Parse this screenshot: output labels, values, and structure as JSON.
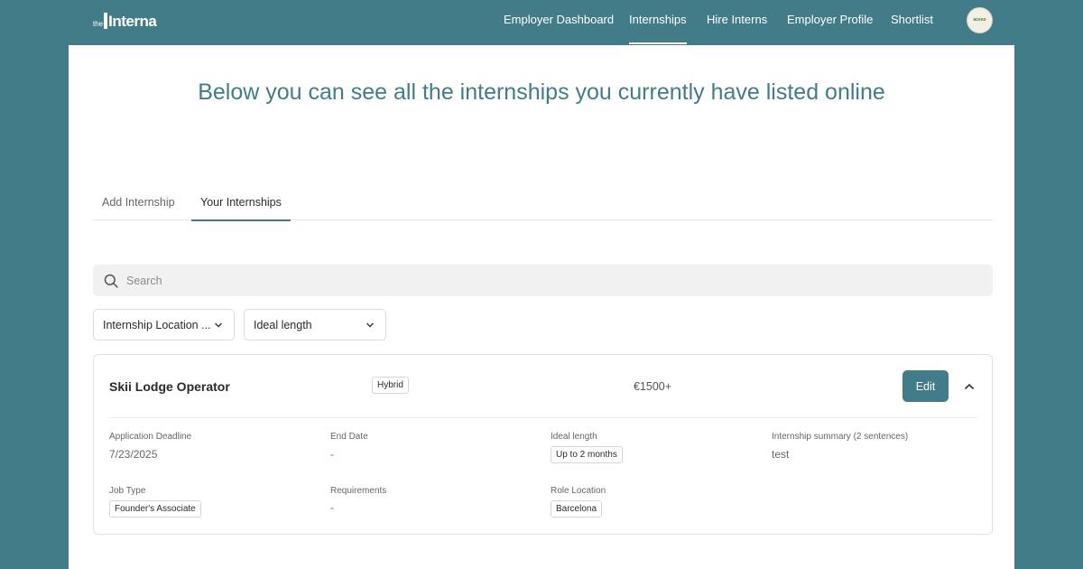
{
  "nav": {
    "logo_prefix": "the",
    "logo_text": "Interna",
    "items": [
      {
        "label": "Employer Dashboard"
      },
      {
        "label": "Internships",
        "active": true
      },
      {
        "label": "Hire Interns"
      },
      {
        "label": "Employer Profile"
      },
      {
        "label": "Shortlist"
      }
    ],
    "avatar_text": "aceso"
  },
  "page": {
    "headline": "Below you can see all the internships you currently have listed online"
  },
  "tabs": [
    {
      "label": "Add Internship"
    },
    {
      "label": "Your Internships",
      "active": true
    }
  ],
  "search": {
    "placeholder": "Search",
    "icon": "search-icon"
  },
  "filters": {
    "location": "Internship Location ...",
    "length": "Ideal length"
  },
  "internship": {
    "title": "Skii Lodge Operator",
    "work_mode": "Hybrid",
    "salary": "€1500+",
    "edit_label": "Edit",
    "fields": {
      "application_deadline": {
        "label": "Application Deadline",
        "value": "7/23/2025"
      },
      "end_date": {
        "label": "End Date",
        "value": "-"
      },
      "ideal_length": {
        "label": "Ideal length",
        "value": "Up to 2 months"
      },
      "summary": {
        "label": "Internship summary (2 sentences)",
        "value": "test"
      },
      "job_type": {
        "label": "Job Type",
        "value": "Founder's Associate"
      },
      "requirements": {
        "label": "Requirements",
        "value": "-"
      },
      "role_location": {
        "label": "Role Location",
        "value": "Barcelona"
      }
    }
  },
  "colors": {
    "brand": "#427c89",
    "panel": "#ffffff",
    "search_bg": "#f1f1f1"
  }
}
